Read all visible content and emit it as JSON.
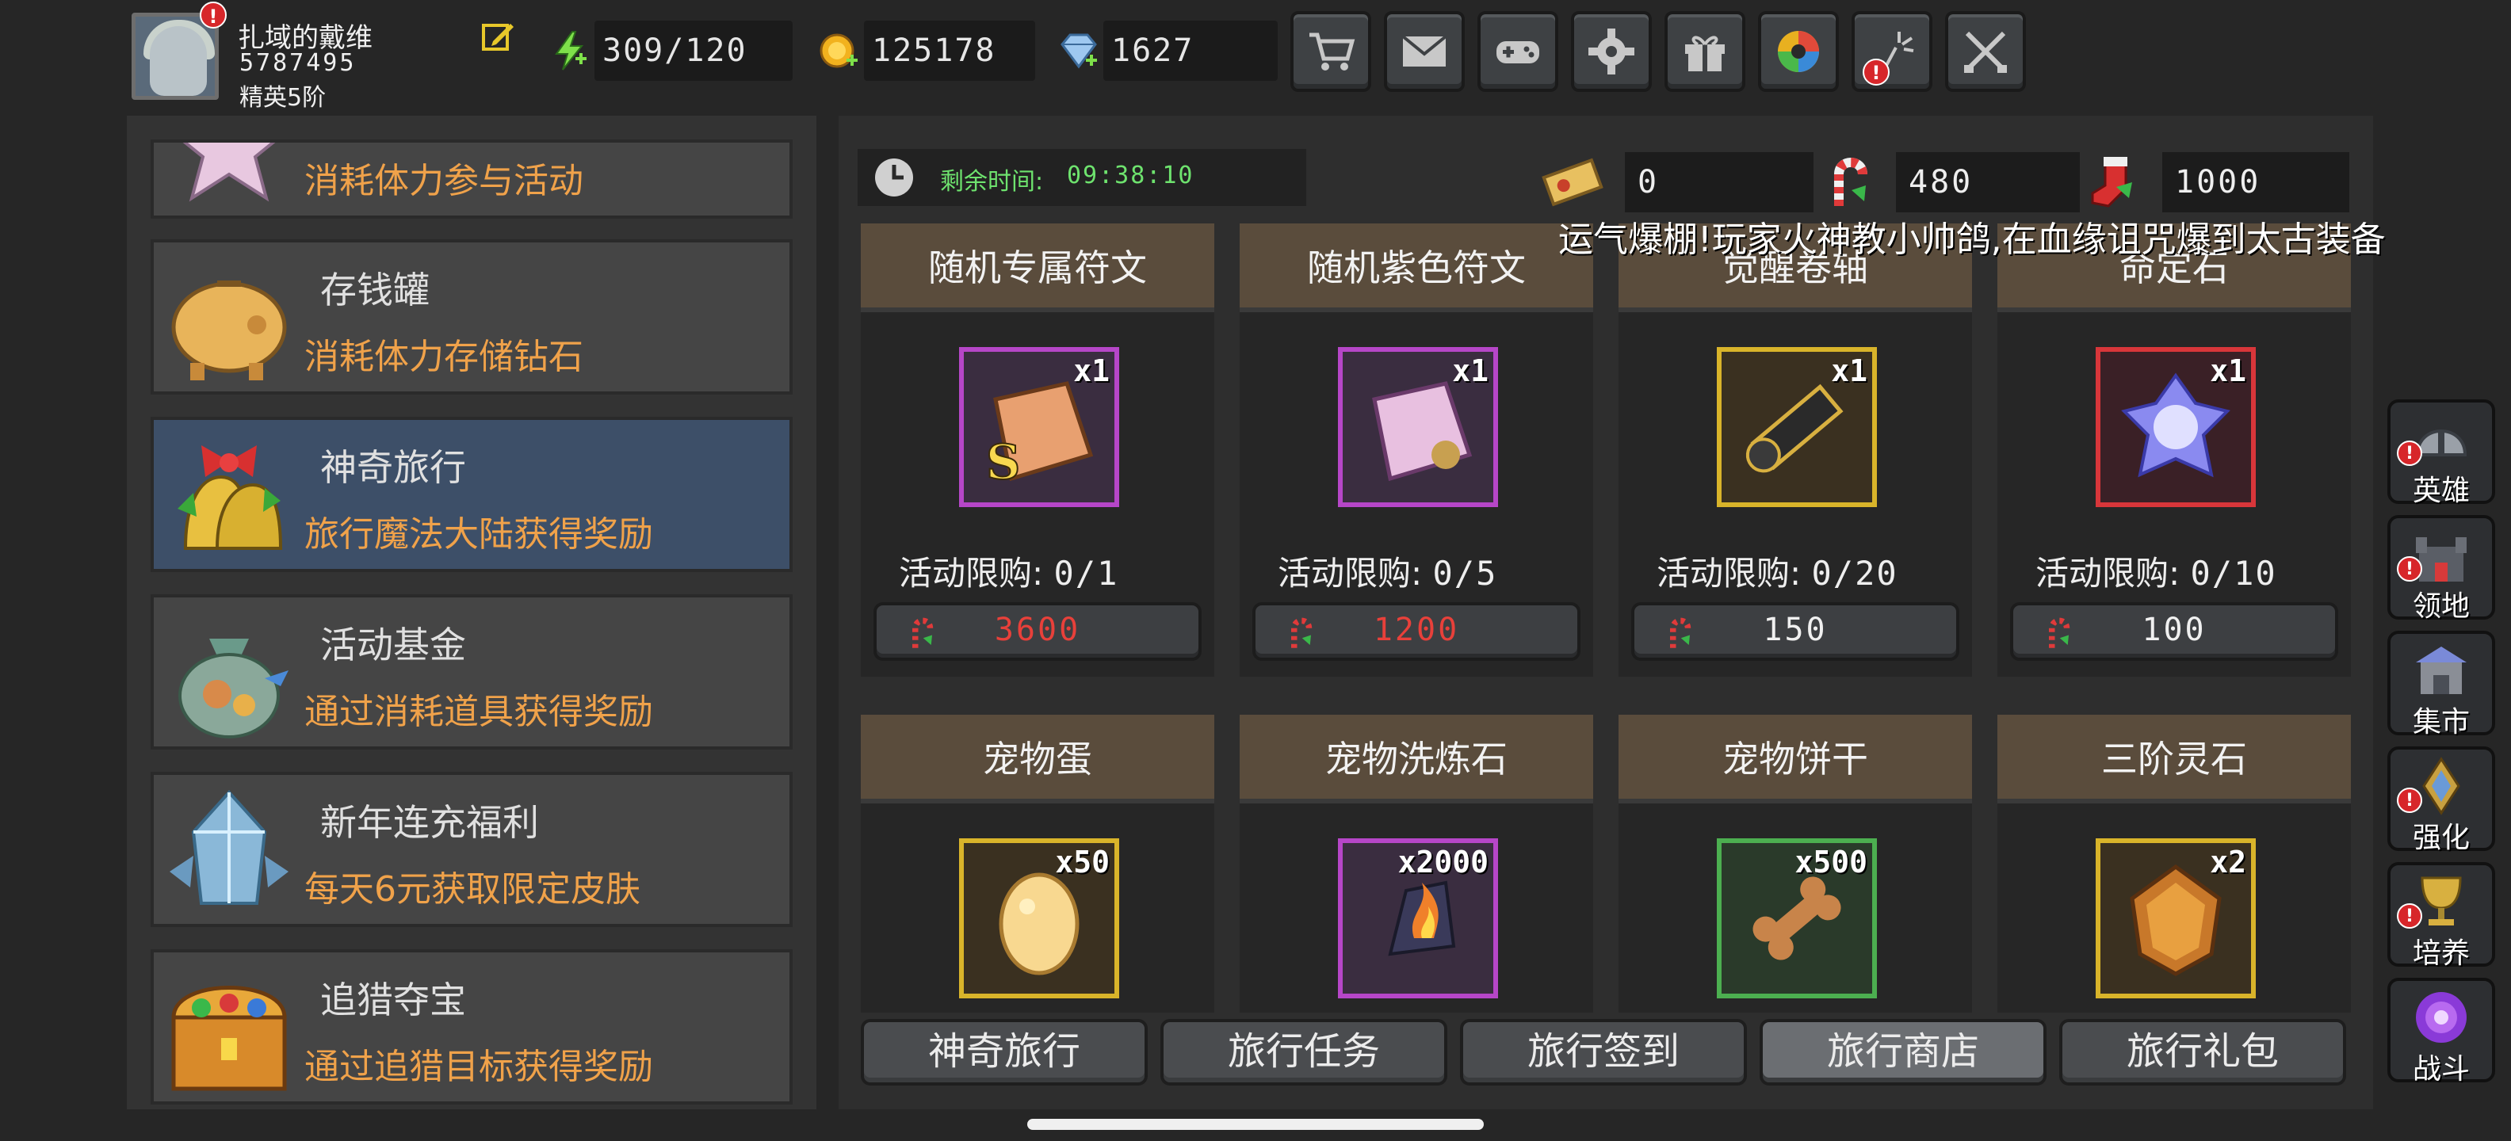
{
  "player": {
    "name": "扎域的戴维",
    "id": "5787495",
    "rank": "精英5阶",
    "alert": "!"
  },
  "resources": {
    "stamina": "309/120",
    "gold": "125178",
    "diamond": "1627"
  },
  "top_buttons": [
    {
      "name": "shop",
      "icon": "cart-icon"
    },
    {
      "name": "mail",
      "icon": "mail-icon"
    },
    {
      "name": "gamepad",
      "icon": "gamepad-icon"
    },
    {
      "name": "settings",
      "icon": "gear-icon"
    },
    {
      "name": "gift",
      "icon": "gift-icon"
    },
    {
      "name": "aperture",
      "icon": "aperture-icon"
    },
    {
      "name": "fireworks",
      "icon": "fireworks-icon",
      "alert": "!"
    },
    {
      "name": "battle",
      "icon": "crossed-swords-icon"
    }
  ],
  "events": [
    {
      "title": "",
      "desc": "消耗体力参与活动"
    },
    {
      "title": "存钱罐",
      "desc": "消耗体力存储钻石"
    },
    {
      "title": "神奇旅行",
      "desc": "旅行魔法大陆获得奖励"
    },
    {
      "title": "活动基金",
      "desc": "通过消耗道具获得奖励"
    },
    {
      "title": "新年连充福利",
      "desc": "每天6元获取限定皮肤"
    },
    {
      "title": "追猎夺宝",
      "desc": "通过追猎目标获得奖励"
    }
  ],
  "timer": {
    "label": "剩余时间:",
    "value": "09:38:10"
  },
  "currencies": {
    "ticket": "0",
    "candy": "480",
    "stocking": "1000"
  },
  "marquee": "运气爆棚!玩家火神教小帅鸽,在血缘诅咒爆到太古装备",
  "limit_prefix": "活动限购:",
  "shop_items": [
    {
      "name": "随机专属符文",
      "qty": "x1",
      "limit": "0/1",
      "price": "3600",
      "price_color": "#e8403a",
      "frame_color": "#b646c8"
    },
    {
      "name": "随机紫色符文",
      "qty": "x1",
      "limit": "0/5",
      "price": "1200",
      "price_color": "#e8403a",
      "frame_color": "#b646c8"
    },
    {
      "name": "觉醒卷轴",
      "qty": "x1",
      "limit": "0/20",
      "price": "150",
      "price_color": "#f0f0f0",
      "frame_color": "#d9b42a"
    },
    {
      "name": "命定石",
      "qty": "x1",
      "limit": "0/10",
      "price": "100",
      "price_color": "#f0f0f0",
      "frame_color": "#d8363a"
    },
    {
      "name": "宠物蛋",
      "qty": "x50",
      "frame_color": "#d9b42a"
    },
    {
      "name": "宠物洗炼石",
      "qty": "x2000",
      "frame_color": "#b646c8"
    },
    {
      "name": "宠物饼干",
      "qty": "x500",
      "frame_color": "#4caf50"
    },
    {
      "name": "三阶灵石",
      "qty": "x2",
      "frame_color": "#d9b42a"
    }
  ],
  "tabs": [
    "神奇旅行",
    "旅行任务",
    "旅行签到",
    "旅行商店",
    "旅行礼包"
  ],
  "active_tab": "旅行商店",
  "side_nav": [
    {
      "label": "英雄",
      "icon": "helmet-icon",
      "alert": "!"
    },
    {
      "label": "领地",
      "icon": "castle-icon",
      "alert": "!"
    },
    {
      "label": "集市",
      "icon": "market-icon"
    },
    {
      "label": "强化",
      "icon": "upgrade-crystal-icon",
      "alert": "!"
    },
    {
      "label": "培养",
      "icon": "chalice-icon",
      "alert": "!"
    },
    {
      "label": "战斗",
      "icon": "portal-icon"
    }
  ]
}
